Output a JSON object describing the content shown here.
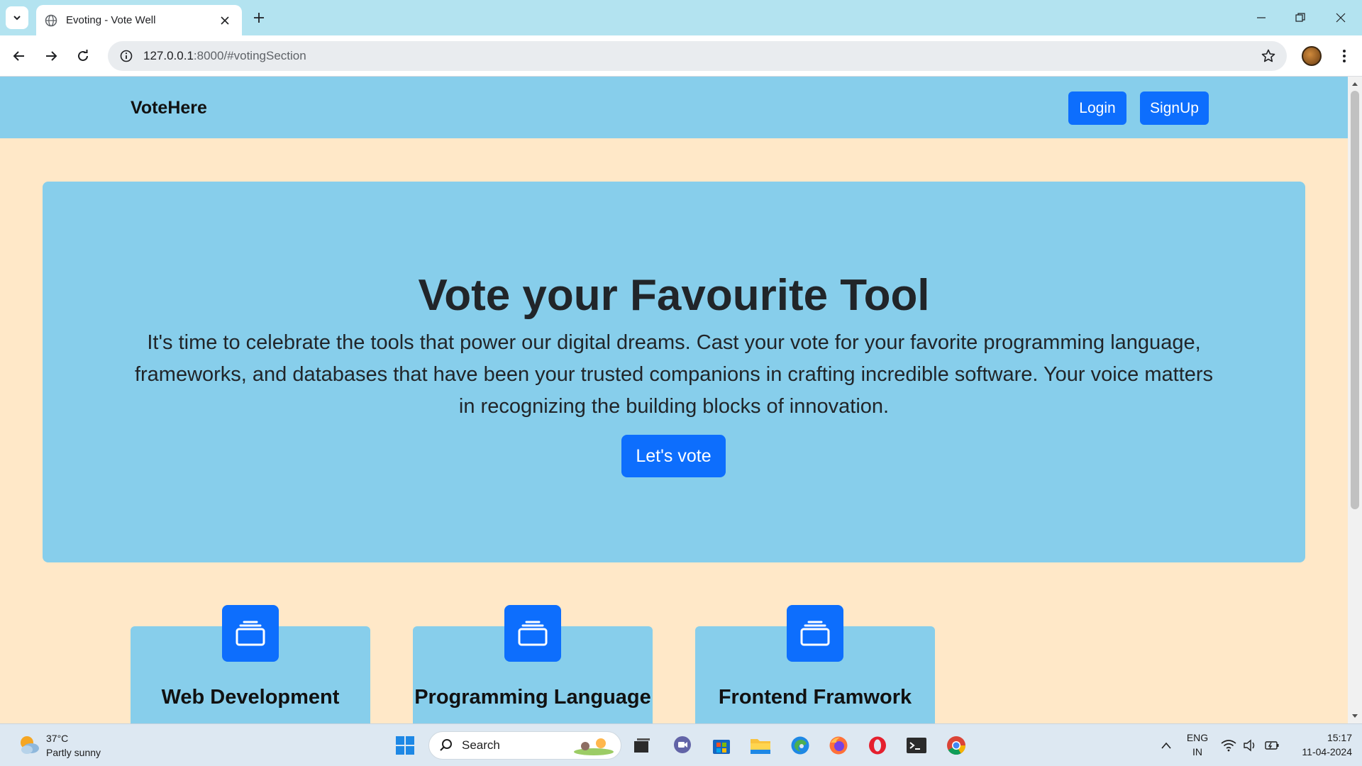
{
  "browser": {
    "tab_title": "Evoting - Vote Well",
    "url_host": "127.0.0.1",
    "url_rest": ":8000/#votingSection"
  },
  "site": {
    "brand": "VoteHere",
    "login_label": "Login",
    "signup_label": "SignUp"
  },
  "hero": {
    "title": "Vote your Favourite Tool",
    "text": "It's time to celebrate the tools that power our digital dreams. Cast your vote for your favorite programming language, frameworks, and databases that have been your trusted companions in crafting incredible software. Your voice matters in recognizing the building blocks of innovation.",
    "cta_label": "Let's vote"
  },
  "cards": [
    {
      "title": "Web Development"
    },
    {
      "title": "Programming Language"
    },
    {
      "title": "Frontend Framwork"
    }
  ],
  "taskbar": {
    "temperature": "37°C",
    "weather": "Partly sunny",
    "search_label": "Search",
    "lang_top": "ENG",
    "lang_bottom": "IN",
    "time": "15:17",
    "date": "11-04-2024"
  },
  "colors": {
    "page_bg": "#ffe8c8",
    "nav_bg": "#87ceeb",
    "primary": "#0d6efd"
  },
  "icons": [
    "chevron-down-icon",
    "globe-icon",
    "close-icon",
    "plus-icon",
    "minimize-icon",
    "restore-icon",
    "back-icon",
    "forward-icon",
    "reload-icon",
    "info-icon",
    "star-icon",
    "kebab-icon",
    "layers-icon",
    "windows-start-icon",
    "search-icon"
  ]
}
